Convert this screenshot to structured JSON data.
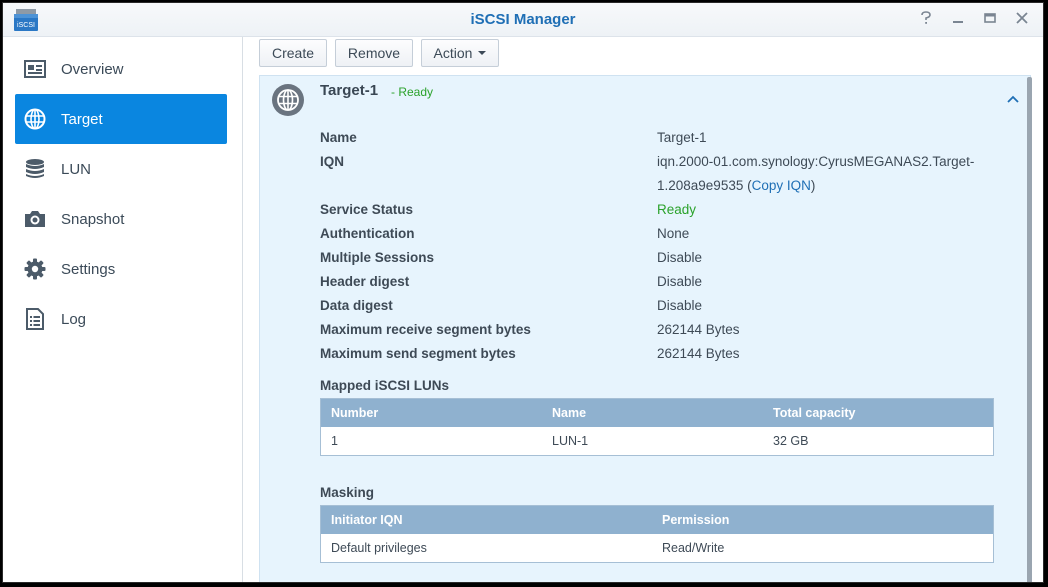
{
  "window": {
    "title": "iSCSI Manager",
    "app_icon_label": "iSCSI"
  },
  "sidebar": {
    "items": [
      {
        "label": "Overview",
        "icon": "overview-icon"
      },
      {
        "label": "Target",
        "icon": "globe-icon",
        "active": true
      },
      {
        "label": "LUN",
        "icon": "database-icon"
      },
      {
        "label": "Snapshot",
        "icon": "camera-icon"
      },
      {
        "label": "Settings",
        "icon": "gear-icon"
      },
      {
        "label": "Log",
        "icon": "log-icon"
      }
    ]
  },
  "toolbar": {
    "create_label": "Create",
    "remove_label": "Remove",
    "action_label": "Action"
  },
  "target": {
    "name": "Target-1",
    "status": "- Ready",
    "details": {
      "name_label": "Name",
      "name_value": "Target-1",
      "iqn_label": "IQN",
      "iqn_line1": "iqn.2000-01.com.synology:CyrusMEGANAS2.Target-",
      "iqn_line2": "1.208a9e9535",
      "iqn_open_paren": " (",
      "copy_iqn_label": "Copy IQN",
      "iqn_close_paren": ")",
      "service_status_label": "Service Status",
      "service_status_value": "Ready",
      "authentication_label": "Authentication",
      "authentication_value": "None",
      "multiple_sessions_label": "Multiple Sessions",
      "multiple_sessions_value": "Disable",
      "header_digest_label": "Header digest",
      "header_digest_value": "Disable",
      "data_digest_label": "Data digest",
      "data_digest_value": "Disable",
      "max_recv_label": "Maximum receive segment bytes",
      "max_recv_value": "262144 Bytes",
      "max_send_label": "Maximum send segment bytes",
      "max_send_value": "262144 Bytes"
    },
    "mapped_luns": {
      "title": "Mapped iSCSI LUNs",
      "columns": [
        "Number",
        "Name",
        "Total capacity"
      ],
      "rows": [
        [
          "1",
          "LUN-1",
          "32 GB"
        ]
      ]
    },
    "masking": {
      "title": "Masking",
      "columns": [
        "Initiator IQN",
        "Permission"
      ],
      "rows": [
        [
          "Default privileges",
          "Read/Write"
        ]
      ]
    }
  },
  "colors": {
    "accent": "#0a86e0",
    "title_blue": "#1f6fb5",
    "ready_green": "#2ba22b",
    "panel_bg": "#e7f4fd",
    "grid_header": "#8fb1cf"
  }
}
